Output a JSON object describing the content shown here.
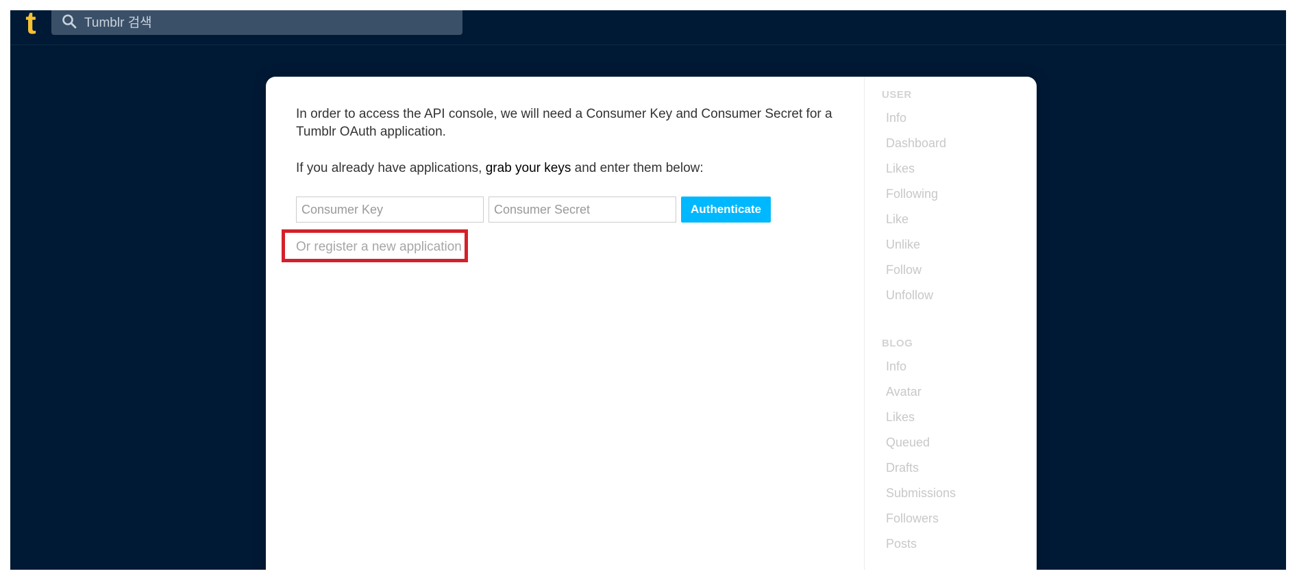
{
  "header": {
    "logo_letter": "t",
    "search_placeholder": "Tumblr 검색"
  },
  "main": {
    "intro_text": "In order to access the API console, we will need a Consumer Key and Consumer Secret for a Tumblr OAuth application.",
    "already_prefix": "If you already have applications, ",
    "grab_keys_link": "grab your keys",
    "already_suffix": " and enter them below:",
    "consumer_key_placeholder": "Consumer Key",
    "consumer_key_value": "",
    "consumer_secret_placeholder": "Consumer Secret",
    "consumer_secret_value": "",
    "authenticate_label": "Authenticate",
    "register_link": "Or register a new application"
  },
  "sidebar": {
    "user_heading": "USER",
    "user_items": [
      "Info",
      "Dashboard",
      "Likes",
      "Following",
      "Like",
      "Unlike",
      "Follow",
      "Unfollow"
    ],
    "blog_heading": "BLOG",
    "blog_items": [
      "Info",
      "Avatar",
      "Likes",
      "Queued",
      "Drafts",
      "Submissions",
      "Followers",
      "Posts"
    ]
  },
  "colors": {
    "background": "#001935",
    "logo": "#f7c132",
    "accent_button": "#00b8ff",
    "highlight_box": "#d4202a"
  }
}
